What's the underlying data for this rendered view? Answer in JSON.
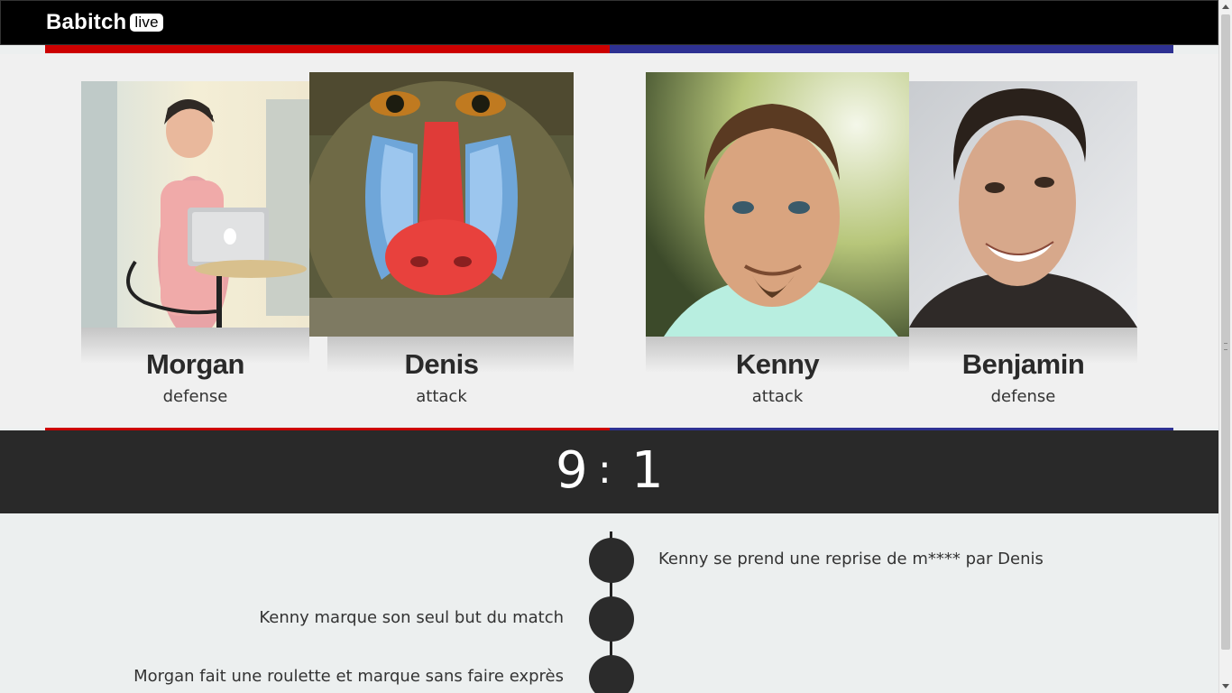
{
  "app": {
    "brand": "Babitch",
    "badge": "live"
  },
  "colors": {
    "red_team": "#cc0000",
    "blue_team": "#2e3192",
    "scoreboard_bg": "#292929",
    "timeline_dot": "#2b2b2b"
  },
  "players": [
    {
      "name": "Morgan",
      "role": "defense",
      "team": "red"
    },
    {
      "name": "Denis",
      "role": "attack",
      "team": "red"
    },
    {
      "name": "Kenny",
      "role": "attack",
      "team": "blue"
    },
    {
      "name": "Benjamin",
      "role": "defense",
      "team": "blue"
    }
  ],
  "score": {
    "red": "9",
    "separator": ":",
    "blue": "1"
  },
  "timeline": [
    {
      "text": "Kenny se prend une reprise de m**** par Denis",
      "side": "right"
    },
    {
      "text": "Kenny marque son seul but du match",
      "side": "left"
    },
    {
      "text": "Morgan fait une roulette et marque sans faire exprès",
      "side": "left"
    }
  ]
}
